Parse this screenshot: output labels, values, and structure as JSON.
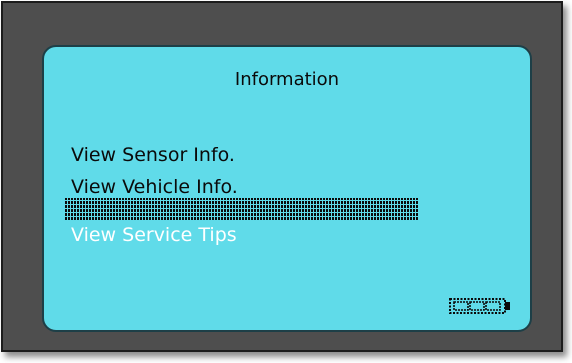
{
  "screen": {
    "title": "Information",
    "menu_items": [
      {
        "label": "View Sensor Info."
      },
      {
        "label": "View Vehicle Info."
      },
      {
        "label": "View Service Tips",
        "selected": true
      }
    ]
  },
  "status": {
    "battery_icon": "battery-icon",
    "battery_level": 1.0
  },
  "colors": {
    "screen_bg": "#60dbe9",
    "device_frame": "#4e4e4e",
    "text": "#0a0a0a",
    "selected_text": "#ffffff"
  }
}
